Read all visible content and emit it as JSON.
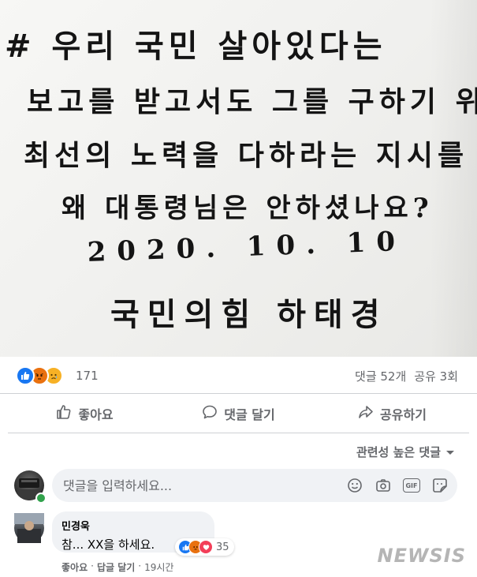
{
  "post": {
    "handwritten_note": [
      "# 우리 국민 살아있다는",
      "보고를 받고서도 그를 구하기 위한",
      "최선의 노력을 다하라는 지시를",
      "왜 대통령님은 안하셨나요?",
      "2020. 10. 10",
      "국민의힘 하태경"
    ]
  },
  "reactions": {
    "total": "171",
    "comments": "댓글 52개",
    "shares": "공유 3회",
    "colors": {
      "like": "#1877f2",
      "angry": "#e9710f",
      "sad": "#f7b125",
      "love": "#f33e58"
    }
  },
  "actions": {
    "like": "좋아요",
    "comment": "댓글 달기",
    "share": "공유하기"
  },
  "sort": {
    "label": "관련성 높은 댓글"
  },
  "composer": {
    "placeholder": "댓글을 입력하세요...",
    "icons": [
      "emoji-icon",
      "camera-icon",
      "gif-icon",
      "sticker-icon"
    ],
    "gif_label": "GIF"
  },
  "comment": {
    "author": "민경욱",
    "text": "참... XX을 하세요.",
    "reaction_count": "35",
    "like_label": "좋아요",
    "reply_label": "답글 달기",
    "time": "19시간"
  },
  "watermark": "NEWSIS"
}
